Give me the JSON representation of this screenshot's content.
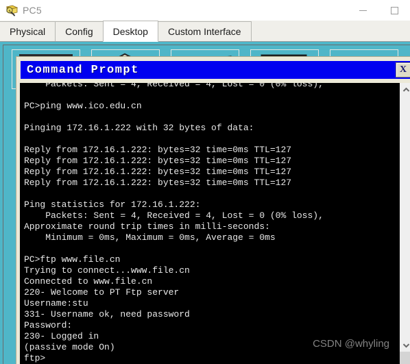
{
  "window": {
    "title": "PC5",
    "icon": "packet-tracer-icon",
    "minimize_label": "Minimize",
    "maximize_label": "Maximize"
  },
  "tabs": [
    {
      "label": "Physical",
      "active": false
    },
    {
      "label": "Config",
      "active": false
    },
    {
      "label": "Desktop",
      "active": true
    },
    {
      "label": "Custom Interface",
      "active": false
    }
  ],
  "desktop": {
    "background_color": "#4fb6c8",
    "icons": [
      {
        "name": "ip-configuration-icon"
      },
      {
        "name": "dial-up-icon"
      },
      {
        "name": "terminal-icon"
      },
      {
        "name": "command-prompt-icon"
      },
      {
        "name": "web-browser-icon"
      }
    ]
  },
  "command_prompt": {
    "title": "Command Prompt",
    "close_label": "X",
    "title_bar_color": "#0000f0",
    "terminal_bg": "#000000",
    "terminal_fg": "#e8e8e8",
    "lines": [
      "    Packets: Sent = 4, Received = 4, Lost = 0 (0% loss),",
      "",
      "PC>ping www.ico.edu.cn",
      "",
      "Pinging 172.16.1.222 with 32 bytes of data:",
      "",
      "Reply from 172.16.1.222: bytes=32 time=0ms TTL=127",
      "Reply from 172.16.1.222: bytes=32 time=0ms TTL=127",
      "Reply from 172.16.1.222: bytes=32 time=0ms TTL=127",
      "Reply from 172.16.1.222: bytes=32 time=0ms TTL=127",
      "",
      "Ping statistics for 172.16.1.222:",
      "    Packets: Sent = 4, Received = 4, Lost = 0 (0% loss),",
      "Approximate round trip times in milli-seconds:",
      "    Minimum = 0ms, Maximum = 0ms, Average = 0ms",
      "",
      "PC>ftp www.file.cn",
      "Trying to connect...www.file.cn",
      "Connected to www.file.cn",
      "220- Welcome to PT Ftp server",
      "Username:stu",
      "331- Username ok, need password",
      "Password:",
      "230- Logged in",
      "(passive mode On)",
      "ftp>"
    ],
    "scrollbar": {
      "up_label": "scroll up",
      "down_label": "scroll down"
    }
  },
  "watermark": "CSDN @whyling"
}
